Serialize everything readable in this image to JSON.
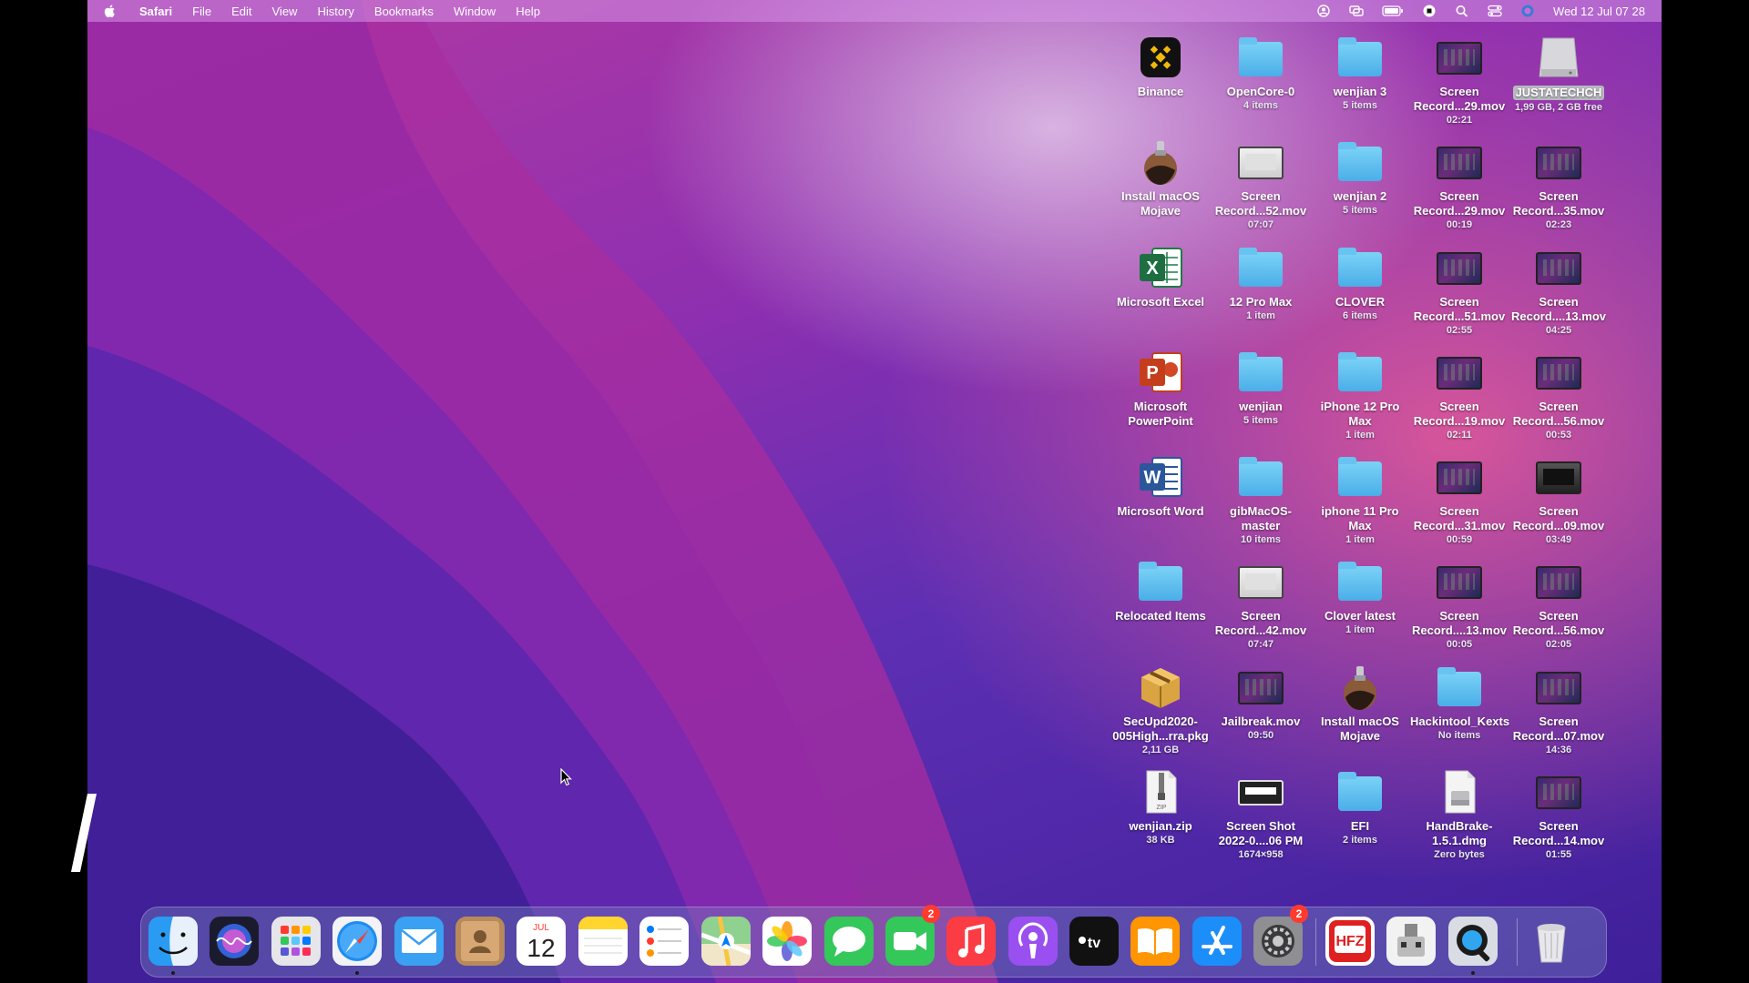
{
  "menubar": {
    "app_name": "Safari",
    "items": [
      "File",
      "Edit",
      "View",
      "History",
      "Bookmarks",
      "Window",
      "Help"
    ],
    "clock": "Wed 12 Jul  07 28"
  },
  "desktop": {
    "col1": [
      {
        "label": "Binance",
        "sub": "",
        "icon": "binance-icon"
      },
      {
        "label": "Install macOS Mojave",
        "sub": "",
        "icon": "installer-icon"
      },
      {
        "label": "Microsoft Excel",
        "sub": "",
        "icon": "excel-icon"
      },
      {
        "label": "Microsoft PowerPoint",
        "sub": "",
        "icon": "powerpoint-icon"
      },
      {
        "label": "Microsoft Word",
        "sub": "",
        "icon": "word-icon"
      },
      {
        "label": "Relocated Items",
        "sub": "",
        "icon": "folder-icon"
      },
      {
        "label": "SecUpd2020-005High...rra.pkg",
        "sub": "2,11 GB",
        "icon": "package-icon"
      },
      {
        "label": "wenjian.zip",
        "sub": "38 KB",
        "icon": "zip-icon"
      }
    ],
    "col2": [
      {
        "label": "OpenCore-0",
        "sub": "4 items",
        "icon": "folder-icon"
      },
      {
        "label": "Screen Record...52.mov",
        "sub": "07:07",
        "icon": "video-thumbnail-icon"
      },
      {
        "label": "12 Pro Max",
        "sub": "1 item",
        "icon": "folder-icon"
      },
      {
        "label": "wenjian",
        "sub": "5 items",
        "icon": "folder-icon"
      },
      {
        "label": "gibMacOS-master",
        "sub": "10 items",
        "icon": "folder-icon"
      },
      {
        "label": "Screen Record...42.mov",
        "sub": "07:47",
        "icon": "video-thumbnail-icon"
      },
      {
        "label": "Jailbreak.mov",
        "sub": "09:50",
        "icon": "video-thumbnail-icon"
      },
      {
        "label": "Screen Shot 2022-0....06 PM",
        "sub": "1674×958",
        "icon": "screenshot-thumbnail-icon"
      }
    ],
    "col3": [
      {
        "label": "wenjian 3",
        "sub": "5 items",
        "icon": "folder-icon"
      },
      {
        "label": "wenjian 2",
        "sub": "5 items",
        "icon": "folder-icon"
      },
      {
        "label": "CLOVER",
        "sub": "6 items",
        "icon": "folder-icon"
      },
      {
        "label": "iPhone 12 Pro Max",
        "sub": "1 item",
        "icon": "folder-icon"
      },
      {
        "label": "iphone 11 Pro Max",
        "sub": "1 item",
        "icon": "folder-icon"
      },
      {
        "label": "Clover latest",
        "sub": "1 item",
        "icon": "folder-icon"
      },
      {
        "label": "Install macOS Mojave",
        "sub": "",
        "icon": "installer-icon"
      },
      {
        "label": "EFI",
        "sub": "2 items",
        "icon": "folder-icon"
      }
    ],
    "col4": [
      {
        "label": "Screen Record...29.mov",
        "sub": "02:21",
        "icon": "video-thumbnail-icon"
      },
      {
        "label": "Screen Record...29.mov",
        "sub": "00:19",
        "icon": "video-thumbnail-icon"
      },
      {
        "label": "Screen Record...51.mov",
        "sub": "02:55",
        "icon": "video-thumbnail-icon"
      },
      {
        "label": "Screen Record...19.mov",
        "sub": "02:11",
        "icon": "video-thumbnail-icon"
      },
      {
        "label": "Screen Record...31.mov",
        "sub": "00:59",
        "icon": "video-thumbnail-icon"
      },
      {
        "label": "Screen Record....13.mov",
        "sub": "00:05",
        "icon": "video-thumbnail-icon"
      },
      {
        "label": "Hackintool_Kexts",
        "sub": "No items",
        "icon": "folder-icon"
      },
      {
        "label": "HandBrake-1.5.1.dmg",
        "sub": "Zero bytes",
        "icon": "dmg-icon"
      }
    ],
    "col5": [
      {
        "label": "JUSTATECHCH",
        "sub": "1,99 GB, 2 GB free",
        "icon": "disk-icon"
      },
      {
        "label": "Screen Record...35.mov",
        "sub": "02:23",
        "icon": "video-thumbnail-icon"
      },
      {
        "label": "Screen Record....13.mov",
        "sub": "04:25",
        "icon": "video-thumbnail-icon"
      },
      {
        "label": "Screen Record...56.mov",
        "sub": "00:53",
        "icon": "video-thumbnail-icon"
      },
      {
        "label": "Screen Record...09.mov",
        "sub": "03:49",
        "icon": "video-thumbnail-icon"
      },
      {
        "label": "Screen Record...56.mov",
        "sub": "02:05",
        "icon": "video-thumbnail-icon"
      },
      {
        "label": "Screen Record...07.mov",
        "sub": "14:36",
        "icon": "video-thumbnail-icon"
      },
      {
        "label": "Screen Record...14.mov",
        "sub": "01:55",
        "icon": "video-thumbnail-icon"
      }
    ]
  },
  "dock": {
    "calendar_month": "JUL",
    "calendar_day": "12",
    "facetime_badge": "2",
    "settings_badge": "2",
    "apps": [
      "finder-icon",
      "siri-icon",
      "launchpad-icon",
      "safari-icon",
      "mail-icon",
      "contacts-icon",
      "calendar-icon",
      "notes-icon",
      "reminders-icon",
      "maps-icon",
      "photos-icon",
      "messages-icon",
      "facetime-icon",
      "music-icon",
      "podcasts-icon",
      "apple-tv-icon",
      "books-icon",
      "app-store-icon",
      "system-preferences-icon",
      "activator-icon",
      "usb-tool-icon",
      "quicktime-icon",
      "trash-icon"
    ]
  },
  "colors": {
    "folder": "#5cbcf0",
    "badge": "#ff3b30",
    "menubar_bg": "#d696e8"
  }
}
